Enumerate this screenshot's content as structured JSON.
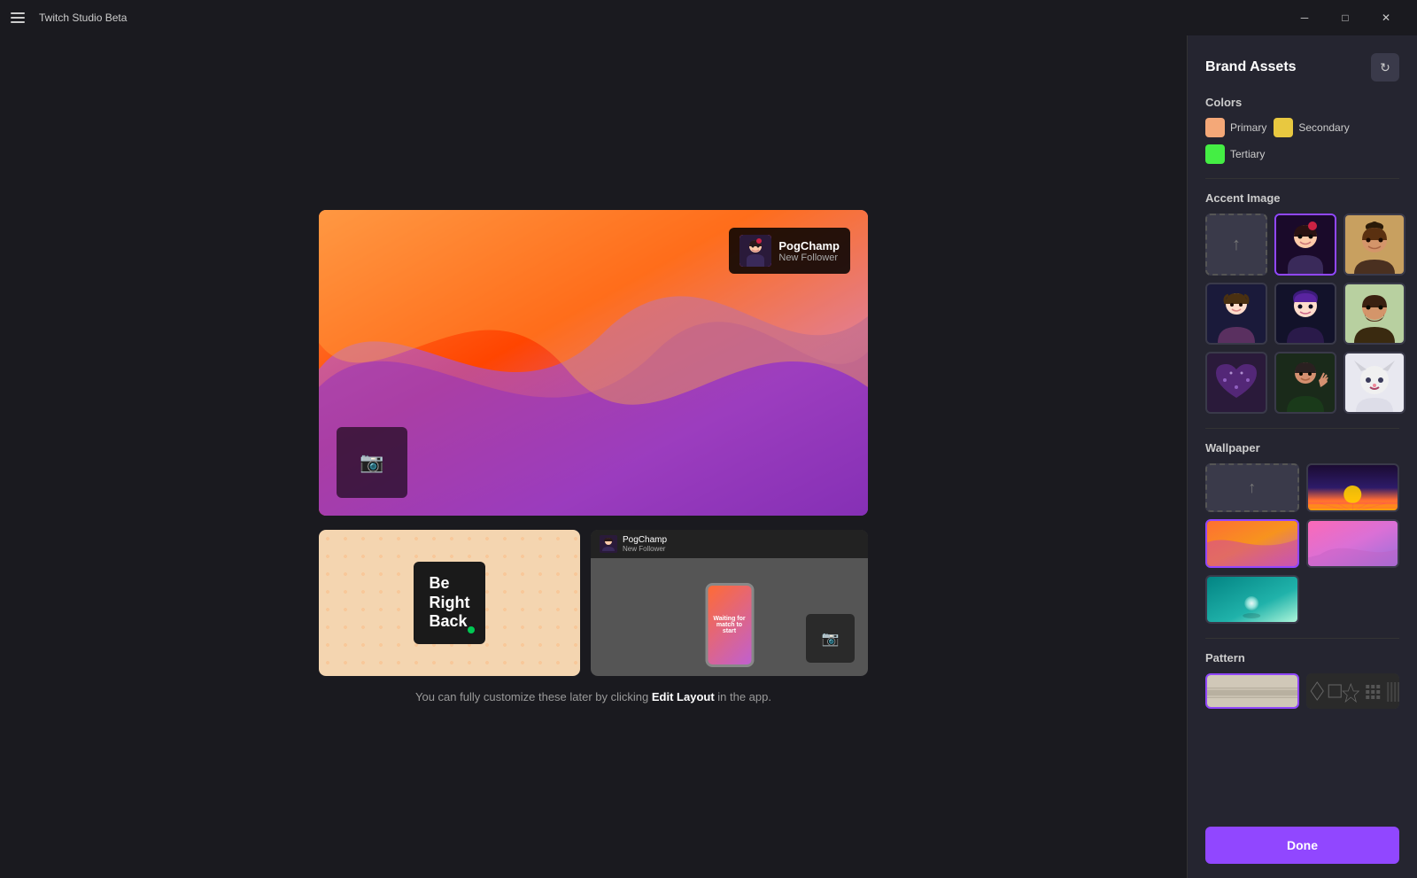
{
  "titlebar": {
    "menu_icon": "☰",
    "title": "Twitch Studio Beta",
    "minimize_icon": "─",
    "maximize_icon": "□",
    "close_icon": "✕"
  },
  "panel": {
    "title": "Brand Assets",
    "refresh_icon": "↻",
    "sections": {
      "colors": {
        "label": "Colors",
        "items": [
          {
            "name": "Primary",
            "color": "#f4a878"
          },
          {
            "name": "Secondary",
            "color": "#e8c840"
          },
          {
            "name": "Tertiary",
            "color": "#44ee44"
          }
        ]
      },
      "accent_image": {
        "label": "Accent Image"
      },
      "wallpaper": {
        "label": "Wallpaper"
      },
      "pattern": {
        "label": "Pattern"
      }
    },
    "done_button": "Done"
  },
  "preview": {
    "notification": {
      "name": "PogChamp",
      "sub": "New Follower"
    },
    "brb": {
      "line1": "Be",
      "line2": "Right",
      "line3": "Back"
    },
    "waiting": {
      "text": "Waiting for match to start"
    }
  },
  "footer": {
    "text_before": "You can fully customize these later by clicking ",
    "link": "Edit Layout",
    "text_after": " in the app."
  }
}
